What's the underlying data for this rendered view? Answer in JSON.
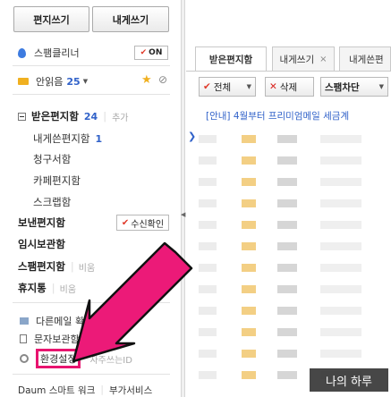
{
  "sidebar": {
    "compose": "편지쓰기",
    "to_me": "내게쓰기",
    "spam_cleaner": "스팸클리너",
    "spam_toggle": "ON",
    "unread_label": "안읽음",
    "unread_count": "25",
    "folders": {
      "inbox": "받은편지함",
      "inbox_count": "24",
      "add": "추가",
      "self_sent": "내게쓴편지함",
      "self_sent_count": "1",
      "bill": "청구서함",
      "cafe": "카페편지함",
      "scrap": "스크랩함",
      "sent": "보낸편지함",
      "receipt": "수신확인",
      "drafts": "임시보관함",
      "spam": "스팸편지함",
      "spam_empty": "비움",
      "trash": "휴지통",
      "trash_empty": "비움"
    },
    "tools": {
      "other_mail": "다른메일 확",
      "sms_storage": "문자보관함",
      "settings": "환경설정",
      "frequent_id": "자주쓰는ID"
    },
    "footer": {
      "smart_work": "Daum 스마트 워크",
      "extra_services": "부가서비스"
    }
  },
  "main": {
    "tabs": {
      "inbox": "받은편지함",
      "compose": "내게쓰기",
      "sent": "내게쓴편"
    },
    "toolbar": {
      "select_all": "전체",
      "delete": "삭제",
      "spam_block": "스팸차단"
    },
    "notice": "[안내] 4월부터 프리미엄메일 세금계"
  },
  "watermark": "나의 하루",
  "colors": {
    "accent_blue": "#3162c9",
    "highlight_pink": "#e8146f",
    "check_red": "#e03a2a"
  }
}
